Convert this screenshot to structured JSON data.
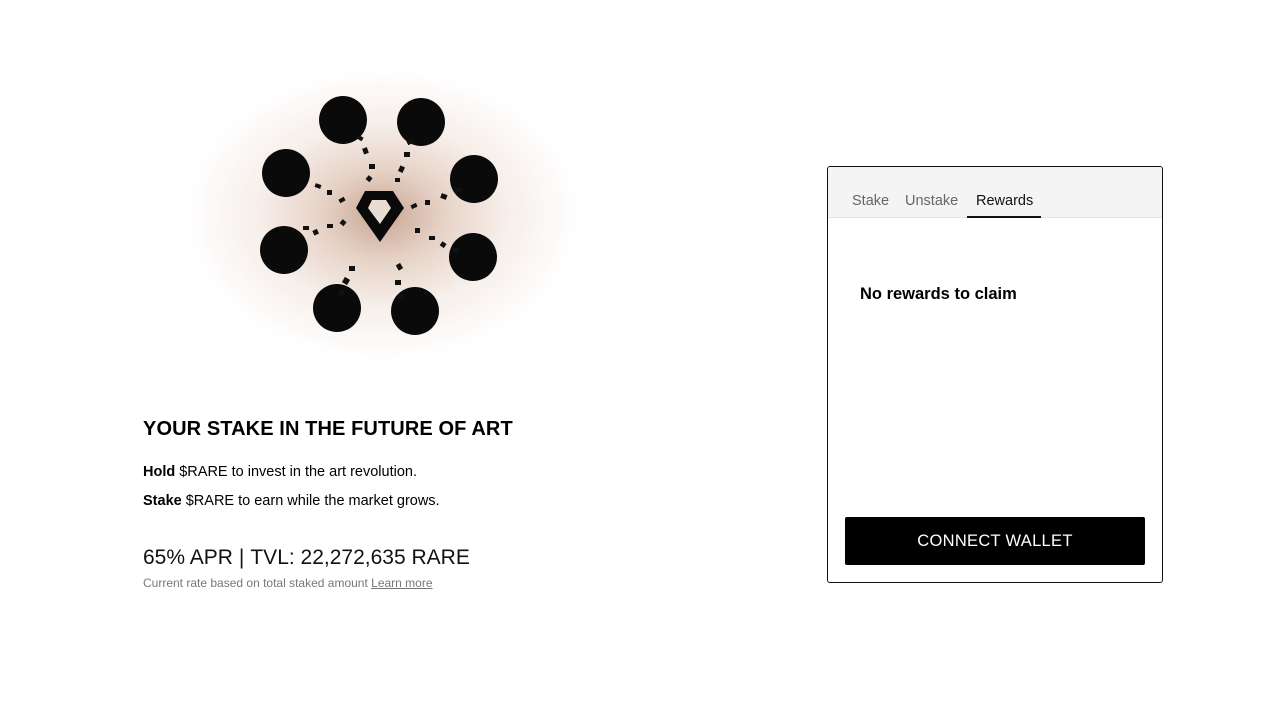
{
  "hero": {
    "image_name": "rare-staking-orbit-illustration",
    "logo_icon": "diamond-logo-icon"
  },
  "intro": {
    "headline": "YOUR STAKE IN THE FUTURE OF ART",
    "hold_bold": "Hold",
    "hold_rest": " $RARE to invest in the art revolution.",
    "stake_bold": "Stake",
    "stake_rest": " $RARE to earn while the market grows."
  },
  "stats": {
    "apr": "65% APR",
    "separator": "|",
    "tvl": "TVL: 22,272,635 RARE",
    "note": "Current rate based on total staked amount ",
    "learn_more": "Learn more"
  },
  "panel": {
    "tabs": [
      {
        "label": "Stake"
      },
      {
        "label": "Unstake"
      },
      {
        "label": "Rewards"
      }
    ],
    "active_tab": "Rewards",
    "empty_message": "No rewards to claim",
    "connect_button": "CONNECT WALLET"
  },
  "colors": {
    "button_bg": "#000000",
    "glow": "#c8a592"
  }
}
